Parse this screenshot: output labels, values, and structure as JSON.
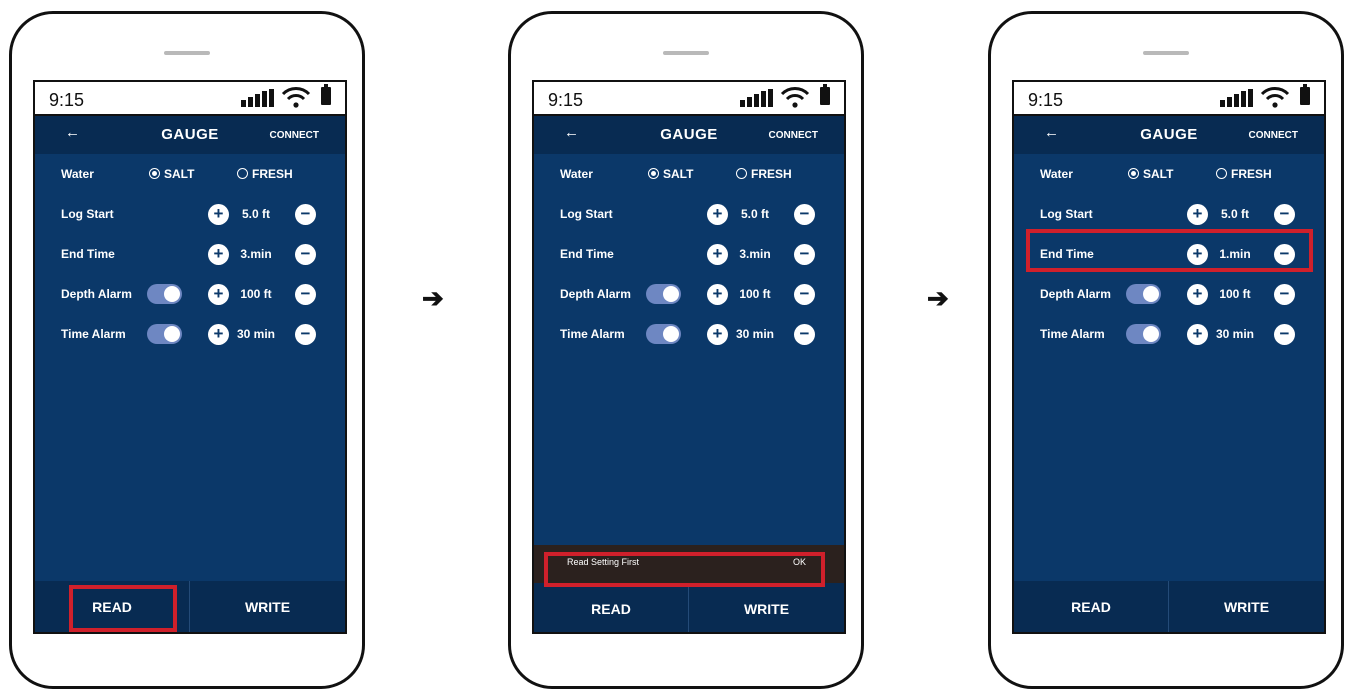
{
  "screens": [
    {
      "status_time": "9:15",
      "back": "←",
      "title": "GAUGE",
      "connect": "CONNECT",
      "water_label": "Water",
      "salt": "SALT",
      "fresh": "FRESH",
      "rows": [
        {
          "label": "Log Start",
          "value": "5.0 ft"
        },
        {
          "label": "End Time",
          "value": "3.min"
        },
        {
          "label": "Depth Alarm",
          "value": "100 ft"
        },
        {
          "label": "Time Alarm",
          "value": "30 min"
        }
      ],
      "read": "READ",
      "write": "WRITE"
    },
    {
      "status_time": "9:15",
      "back": "←",
      "title": "GAUGE",
      "connect": "CONNECT",
      "water_label": "Water",
      "salt": "SALT",
      "fresh": "FRESH",
      "rows": [
        {
          "label": "Log Start",
          "value": "5.0 ft"
        },
        {
          "label": "End Time",
          "value": "3.min"
        },
        {
          "label": "Depth Alarm",
          "value": "100 ft"
        },
        {
          "label": "Time Alarm",
          "value": "30 min"
        }
      ],
      "snackbar": {
        "message": "Read Setting First",
        "action": "OK"
      },
      "read": "READ",
      "write": "WRITE"
    },
    {
      "status_time": "9:15",
      "back": "←",
      "title": "GAUGE",
      "connect": "CONNECT",
      "water_label": "Water",
      "salt": "SALT",
      "fresh": "FRESH",
      "rows": [
        {
          "label": "Log Start",
          "value": "5.0 ft"
        },
        {
          "label": "End Time",
          "value": "1.min"
        },
        {
          "label": "Depth Alarm",
          "value": "100 ft"
        },
        {
          "label": "Time Alarm",
          "value": "30 min"
        }
      ],
      "read": "READ",
      "write": "WRITE"
    }
  ],
  "arrow": "➔",
  "colors": {
    "screen_bg": "#0b3869",
    "bar_bg": "#082b52",
    "toggle": "#6e87c2",
    "highlight": "#d0202b"
  },
  "icons": [
    "back-arrow-icon",
    "signal-icon",
    "wifi-icon",
    "battery-icon",
    "plus-icon",
    "minus-icon",
    "radio-icon",
    "toggle-icon",
    "right-arrow-icon"
  ]
}
